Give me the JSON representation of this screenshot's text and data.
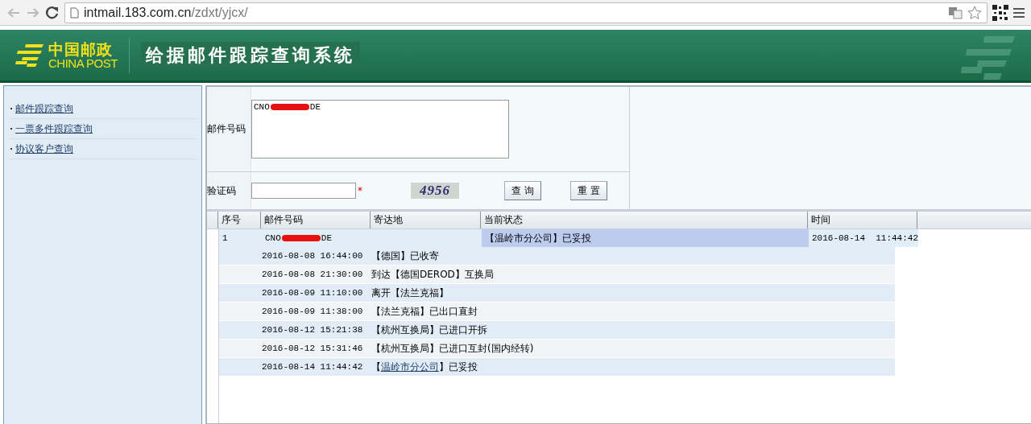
{
  "browser": {
    "url_host": "intmail.183.com.cn",
    "url_path": "/zdxt/yjcx/"
  },
  "header": {
    "logo_cn": "中国邮政",
    "logo_en": "CHINA POST",
    "title": "给据邮件跟踪查询系统"
  },
  "sidebar": {
    "items": [
      {
        "label": "邮件跟踪查询"
      },
      {
        "label": "一票多件跟踪查询"
      },
      {
        "label": "协议客户查询"
      }
    ]
  },
  "form": {
    "number_label": "邮件号码",
    "number_value": {
      "prefix": "CNO",
      "suffix": "DE",
      "redacted": true
    },
    "captcha_label": "验证码",
    "required_mark": "*",
    "captcha": "4956",
    "buttons": [
      "查 询",
      "重 置"
    ]
  },
  "table": {
    "columns": [
      "序号",
      "邮件号码",
      "寄达地",
      "当前状态",
      "时间"
    ],
    "rows": [
      {
        "index": "1",
        "number": {
          "prefix": "CNO",
          "suffix": "DE",
          "redacted": true
        },
        "status": "【温岭市分公司】已妥投",
        "time": "2016-08-14  11:44:42"
      }
    ]
  },
  "events": [
    {
      "kind": "plain",
      "time": "2016-08-08 16:44:00",
      "status": "【德国】已收寄"
    },
    {
      "kind": "plain",
      "time": "2016-08-08 21:30:00",
      "status": "到达【德国DEROD】互换局"
    },
    {
      "kind": "plain",
      "time": "2016-08-09 11:10:00",
      "status": "离开【法兰克福】"
    },
    {
      "kind": "plain",
      "time": "2016-08-09 11:38:00",
      "status": "【法兰克福】已出口直封"
    },
    {
      "kind": "plain",
      "time": "2016-08-12 15:21:38",
      "status": "【杭州互换局】已进口开拆"
    },
    {
      "kind": "plain",
      "time": "2016-08-12 15:31:46",
      "status": "【杭州互换局】已进口互封(国内经转)"
    },
    {
      "kind": "link",
      "time": "2016-08-14 11:44:42",
      "before": "【",
      "link": "温岭市分公司",
      "after": "】已妥投"
    }
  ]
}
